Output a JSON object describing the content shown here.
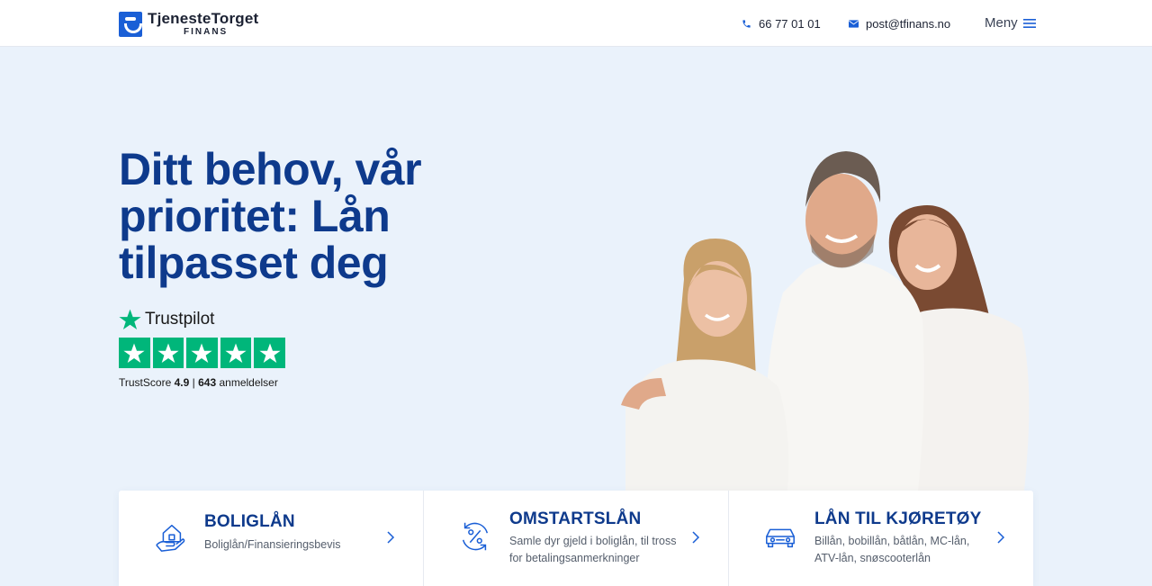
{
  "header": {
    "logo_name": "TjenesteTorget",
    "logo_sub": "FINANS",
    "phone": "66 77 01 01",
    "email": "post@tfinans.no",
    "menu_label": "Meny"
  },
  "hero": {
    "title": "Ditt behov, vår prioritet: Lån tilpasset deg"
  },
  "trustpilot": {
    "brand": "Trustpilot",
    "stars": 5,
    "score_label": "TrustScore",
    "score": "4.9",
    "separator": "|",
    "reviews_count": "643",
    "reviews_label": "anmeldelser",
    "color": "#00b67a"
  },
  "products": [
    {
      "icon": "house-hand-icon",
      "title": "BOLIGLÅN",
      "description": "Boliglån/Finansieringsbevis"
    },
    {
      "icon": "percent-cycle-icon",
      "title": "OMSTARTSLÅN",
      "description": "Samle dyr gjeld i boliglån, til tross for betalingsanmerkninger"
    },
    {
      "icon": "car-icon",
      "title": "LÅN TIL KJØRETØY",
      "description": "Billån, bobillån, båtlån, MC-lån, ATV-lån, snøscooterlån"
    }
  ],
  "colors": {
    "brand_blue": "#0e3a8c",
    "accent_blue": "#1a5fd6",
    "background": "#eaf2fb"
  }
}
